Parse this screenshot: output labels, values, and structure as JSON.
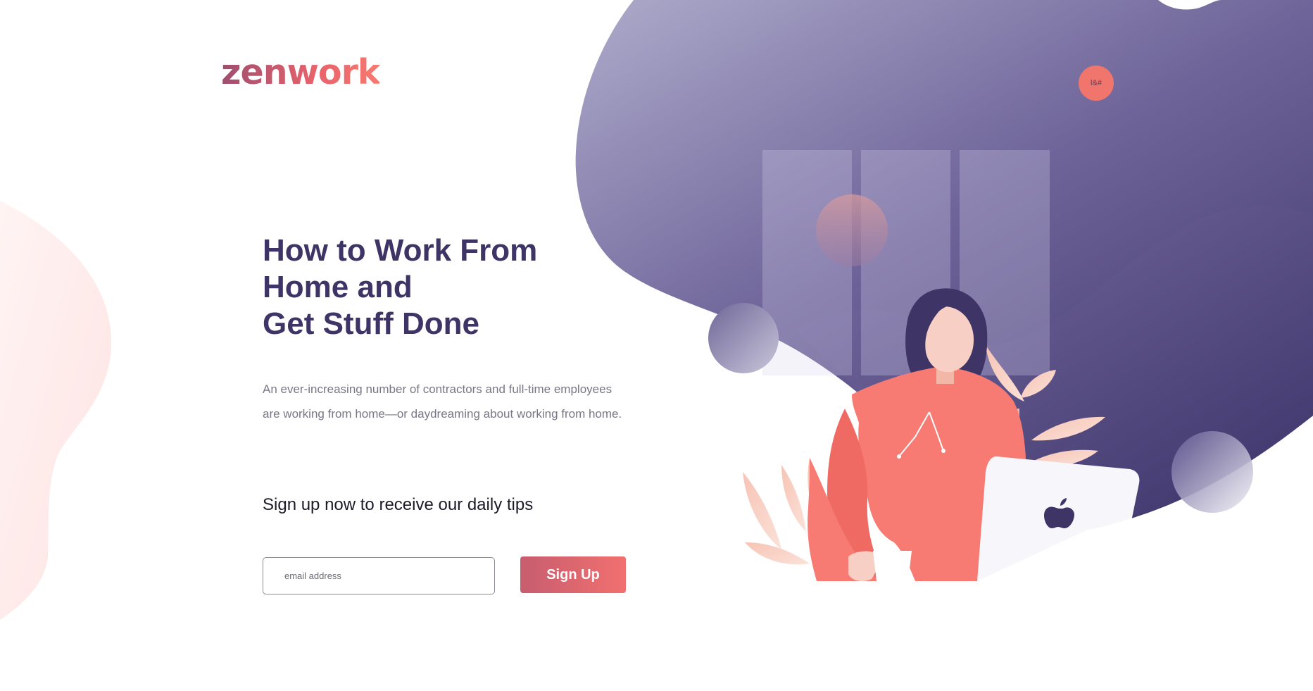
{
  "brand": {
    "logo_text": "zenwork",
    "accent_color": "#f0756c",
    "primary_color": "#3e3466"
  },
  "header": {
    "menu_button_glyph": "l&#"
  },
  "hero": {
    "title_lines": [
      "How to Work From",
      "Home and",
      "Get Stuff Done"
    ],
    "description": "An ever-increasing number of contractors and full-time employees are working from home—or daydreaming about working from home.",
    "signup_prompt": "Sign up now to receive our daily tips"
  },
  "form": {
    "email_placeholder": "email address",
    "email_value": "",
    "submit_label": "Sign Up"
  },
  "illustration": {
    "subject": "woman-with-laptop-and-coffee",
    "laptop_logo_icon": "apple-icon"
  }
}
